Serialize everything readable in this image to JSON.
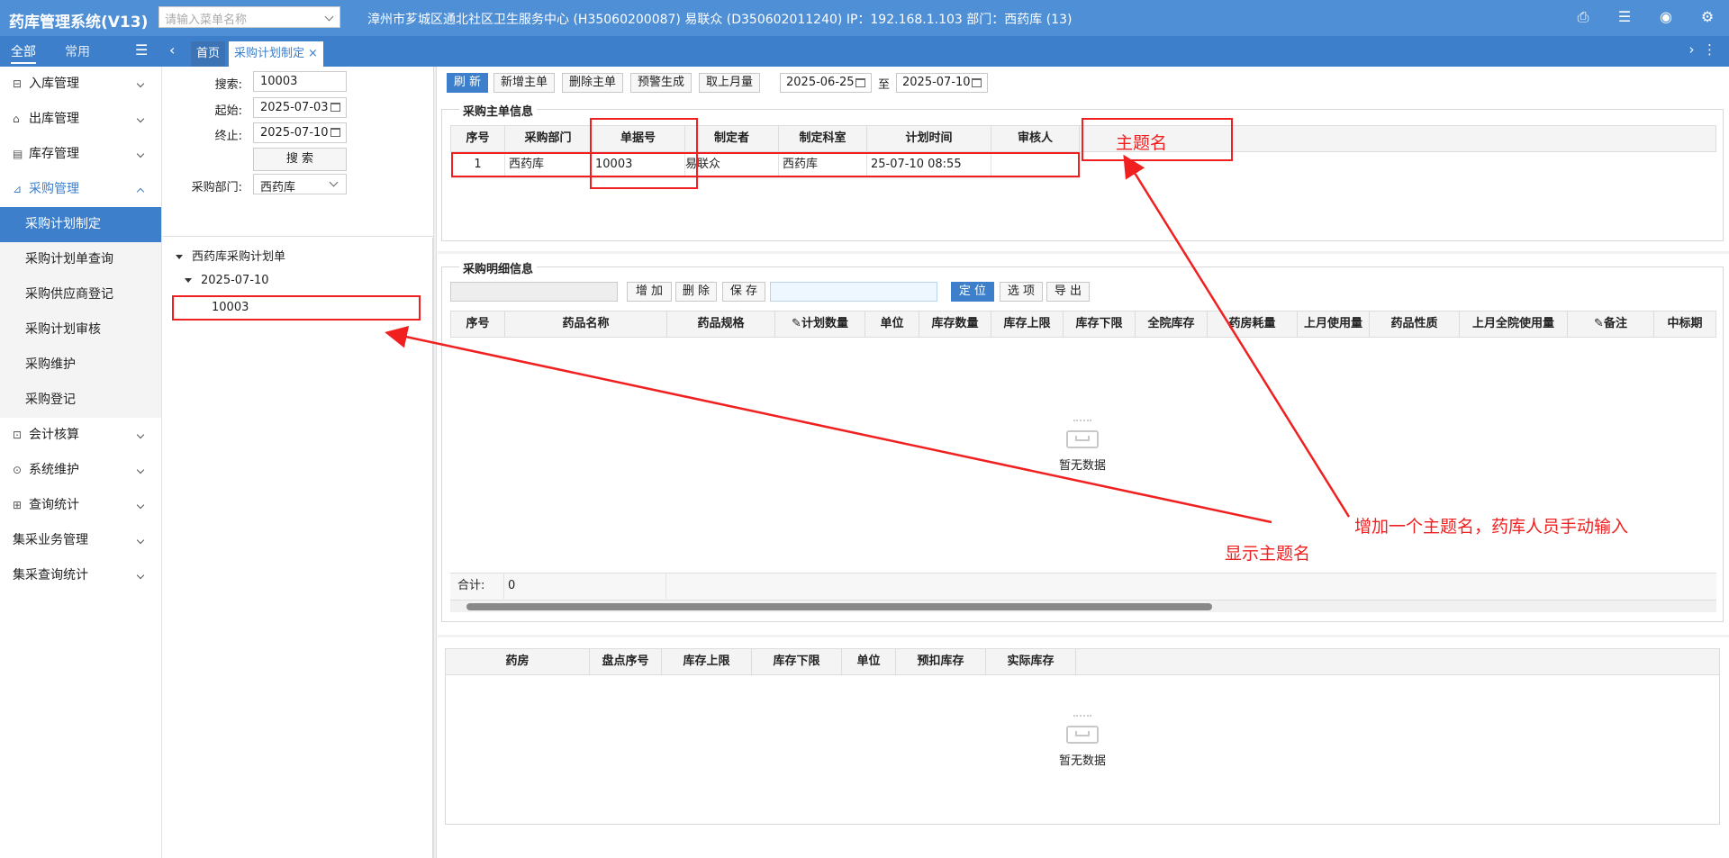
{
  "app": {
    "title": "药库管理系统(V13)",
    "menu_search_placeholder": "请输入菜单名称",
    "site_info": "漳州市芗城区通北社区卫生服务中心 (H35060200087) 易联众 (D350602011240) IP：192.168.1.103 部门：西药库 (13)",
    "top_icons": [
      "monitor-icon",
      "document-icon",
      "eye-icon",
      "gear-icon"
    ]
  },
  "sidebar": {
    "tabs": [
      "全部",
      "常用"
    ],
    "items": [
      {
        "label": "入库管理",
        "icon": "inbox-icon",
        "open": false
      },
      {
        "label": "出库管理",
        "icon": "outbox-icon",
        "open": false
      },
      {
        "label": "库存管理",
        "icon": "inventory-icon",
        "open": false
      },
      {
        "label": "采购管理",
        "icon": "purchase-icon",
        "open": true,
        "children": [
          "采购计划制定",
          "采购计划单查询",
          "采购供应商登记",
          "采购计划审核",
          "采购维护",
          "采购登记"
        ],
        "active_child": 0
      },
      {
        "label": "会计核算",
        "icon": "accounting-icon",
        "open": false
      },
      {
        "label": "系统维护",
        "icon": "maintenance-icon",
        "open": false
      },
      {
        "label": "查询统计",
        "icon": "stats-icon",
        "open": false
      },
      {
        "label": "集采业务管理",
        "icon": "",
        "open": false
      },
      {
        "label": "集采查询统计",
        "icon": "",
        "open": false
      }
    ]
  },
  "tabs": {
    "home": "首页",
    "active": "采购计划制定",
    "close": "×"
  },
  "filter": {
    "search_label": "搜索:",
    "search_value": "10003",
    "start_label": "起始:",
    "start_value": "2025-07-03",
    "end_label": "终止:",
    "end_value": "2025-07-10",
    "search_button": "搜 索",
    "dept_label": "采购部门:",
    "dept_value": "西药库"
  },
  "tree": {
    "root": "西药库采购计划单",
    "date": "2025-07-10",
    "leaf": "10003"
  },
  "toolbar": {
    "buttons": [
      "刷 新",
      "新增主单",
      "删除主单",
      "预警生成",
      "取上月量"
    ],
    "date_from": "2025-06-25",
    "to": "至",
    "date_to": "2025-07-10"
  },
  "master": {
    "legend": "采购主单信息",
    "columns": [
      "序号",
      "采购部门",
      "单据号",
      "制定者",
      "制定科室",
      "计划时间",
      "审核人"
    ],
    "rows": [
      [
        "1",
        "西药库",
        "10003",
        "易联众",
        "西药库",
        "25-07-10 08:55",
        ""
      ]
    ]
  },
  "detail": {
    "legend": "采购明细信息",
    "buttons_a": [
      "增 加",
      "删 除",
      "保 存"
    ],
    "buttons_b": [
      "定 位",
      "选 项",
      "导 出"
    ],
    "columns": [
      "序号",
      "药品名称",
      "药品规格",
      "计划数量",
      "单位",
      "库存数量",
      "库存上限",
      "库存下限",
      "全院库存",
      "药房耗量",
      "上月使用量",
      "药品性质",
      "上月全院使用量",
      "备注",
      "中标期"
    ],
    "empty": "暂无数据",
    "total_label": "合计:",
    "total_value": "0"
  },
  "stock": {
    "columns": [
      "药房",
      "盘点序号",
      "库存上限",
      "库存下限",
      "单位",
      "预扣库存",
      "实际库存"
    ],
    "empty": "暂无数据"
  },
  "annotations": {
    "theme_box": "主题名",
    "note_add": "增加一个主题名，药库人员手动输入",
    "note_show": "显示主题名"
  }
}
